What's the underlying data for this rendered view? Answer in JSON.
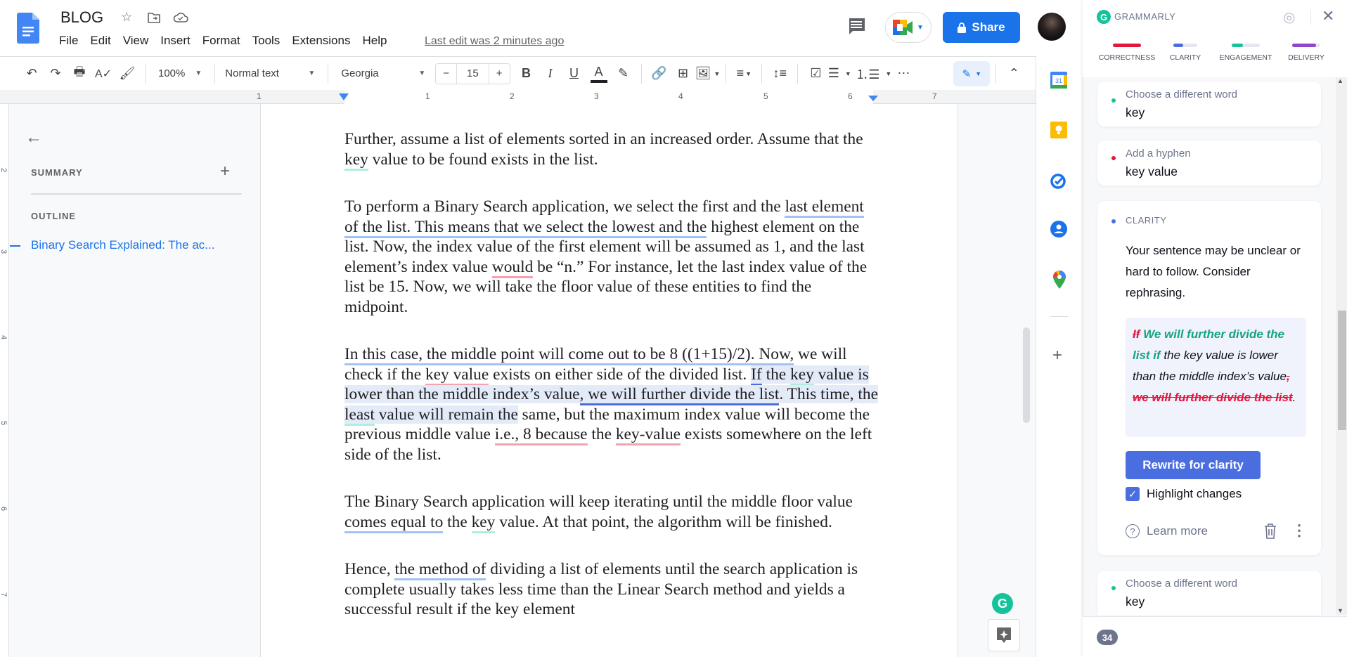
{
  "header": {
    "title": "BLOG",
    "menu": [
      "File",
      "Edit",
      "View",
      "Insert",
      "Format",
      "Tools",
      "Extensions",
      "Help"
    ],
    "last_edit": "Last edit was 2 minutes ago",
    "share_label": "Share"
  },
  "toolbar": {
    "zoom": "100%",
    "style": "Normal text",
    "font": "Georgia",
    "font_size": "15",
    "minus": "−",
    "plus": "+"
  },
  "ruler": {
    "h_ticks": [
      "1",
      "1",
      "2",
      "3",
      "4",
      "5",
      "6",
      "7"
    ],
    "v_ticks": [
      "2",
      "3",
      "4",
      "5",
      "6",
      "7"
    ]
  },
  "outline": {
    "summary_label": "SUMMARY",
    "outline_label": "OUTLINE",
    "items": [
      "Binary Search Explained: The ac..."
    ]
  },
  "document": {
    "p1": [
      "Further, assume a list of elements sorted in an increased order. Assume that the ",
      "key",
      " value to be found exists in the list."
    ],
    "p2": {
      "a": "To perform a Binary Search application, we select the first and the ",
      "b": "last element of the list. This means that we select the lowest and the",
      "c": " highest element on the list. Now, the index value of the first element will be assumed as 1, and the last element’s index value ",
      "d": "would",
      "e": " be “n.” For instance, let the last index value of the list be 15. Now, we will take the floor value of these entities to find the midpoint."
    },
    "p3": {
      "a": "In this case, the middle point will come out to be 8 ((1+15)/2). Now,",
      "b": " we will check if the ",
      "c": "key value",
      "d": " exists on either side of the divided list. ",
      "e": "If",
      "f": " the ",
      "g": "key",
      "h": " value is lower than the middle index’s value",
      "i": ", we will further divide the list",
      "j": ". This time, the ",
      "k": "least",
      "l": " value will remain the",
      "m": " same, but the maximum index value will become the previous middle value ",
      "n": "i.e., 8 because",
      "o": " the ",
      "p": "key-value",
      "q": " exists somewhere on the left side of the list."
    },
    "p4": {
      "a": "The Binary Search application will keep iterating until the middle floor value ",
      "b": "comes equal to",
      "c": " the ",
      "d": "key",
      "e": " value. At that point, the algorithm will be finished."
    },
    "p5": {
      "a": "Hence, ",
      "b": "the method of",
      "c": " dividing a list of elements until the search application is complete usually takes less time than the Linear Search method and yields a successful result if the key element"
    }
  },
  "grammarly": {
    "title": "GRAMMARLY",
    "categories": [
      {
        "label": "CORRECTNESS",
        "color": "#e2173c",
        "fill": 1.0
      },
      {
        "label": "CLARITY",
        "color": "#4a6ee0",
        "fill": 0.4
      },
      {
        "label": "ENGAGEMENT",
        "color": "#15c39a",
        "fill": 0.4
      },
      {
        "label": "DELIVERY",
        "color": "#9146c9",
        "fill": 0.85
      }
    ],
    "cards": [
      {
        "title": "Choose a different word",
        "value": "key",
        "color": "#15c39a"
      },
      {
        "title": "Add a hyphen",
        "value": "key value",
        "color": "#e2173c"
      }
    ],
    "clarity_card": {
      "label": "CLARITY",
      "message": "Your sentence may be unclear or hard to follow. Consider rephrasing.",
      "preview": {
        "del1": "If",
        "ins1": "We will further divide the list if",
        "keep1": " the key value is lower than the middle index’s value",
        "del2": ", we will further divide the list",
        "keep2": "."
      },
      "button": "Rewrite for clarity",
      "checkbox_label": "Highlight changes",
      "checkbox_checked": true,
      "learn_more": "Learn more"
    },
    "bottom_card": {
      "title": "Choose a different word",
      "value": "key"
    },
    "alert_count": "34"
  }
}
